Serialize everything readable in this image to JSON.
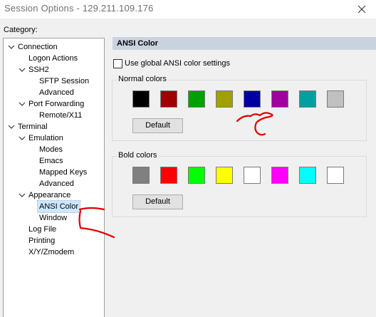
{
  "window": {
    "title": "Session Options - 129.211.109.176"
  },
  "category_label": "Category:",
  "tree": {
    "items": [
      {
        "label": "Connection",
        "expanded": true
      },
      {
        "label": "Logon Actions"
      },
      {
        "label": "SSH2",
        "expanded": true
      },
      {
        "label": "SFTP Session"
      },
      {
        "label": "Advanced"
      },
      {
        "label": "Port Forwarding",
        "expanded": true
      },
      {
        "label": "Remote/X11"
      },
      {
        "label": "Terminal",
        "expanded": true
      },
      {
        "label": "Emulation",
        "expanded": true
      },
      {
        "label": "Modes"
      },
      {
        "label": "Emacs"
      },
      {
        "label": "Mapped Keys"
      },
      {
        "label": "Advanced"
      },
      {
        "label": "Appearance",
        "expanded": true
      },
      {
        "label": "ANSI Color",
        "selected": true
      },
      {
        "label": "Window"
      },
      {
        "label": "Log File"
      },
      {
        "label": "Printing"
      },
      {
        "label": "X/Y/Zmodem"
      }
    ]
  },
  "panel": {
    "title": "ANSI Color",
    "use_global_label": "Use global ANSI color settings",
    "use_global_checked": false,
    "normal": {
      "label": "Normal colors",
      "colors": [
        "#000000",
        "#a00000",
        "#00a000",
        "#a0a000",
        "#0000a0",
        "#a000a0",
        "#00a0a0",
        "#c0c0c0"
      ],
      "default_label": "Default"
    },
    "bold": {
      "label": "Bold colors",
      "colors": [
        "#808080",
        "#ff0000",
        "#00ff00",
        "#ffff00",
        "#ffffff",
        "#ff00ff",
        "#00ffff",
        "#ffffff"
      ],
      "default_label": "Default"
    }
  },
  "annotation_color": "#e00000"
}
